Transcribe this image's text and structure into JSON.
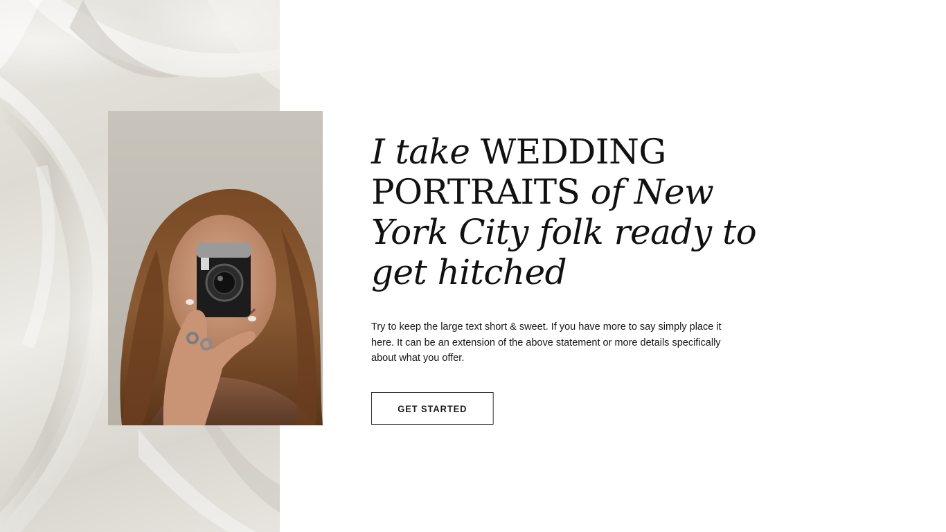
{
  "hero": {
    "headline": {
      "seg1": "I take",
      "seg2": " WEDDING PORTRAITS ",
      "seg3": "of New York City folk ready to get hitched"
    },
    "body": "Try to keep the large text short & sweet. If you have more to say simply place it here. It can be an extension of the above statement or more details specifically about what you offer.",
    "cta_label": "GET STARTED"
  },
  "colors": {
    "background": "#ffffff",
    "text": "#111111",
    "fabric": "#e4e1db",
    "button_border": "#222222"
  }
}
